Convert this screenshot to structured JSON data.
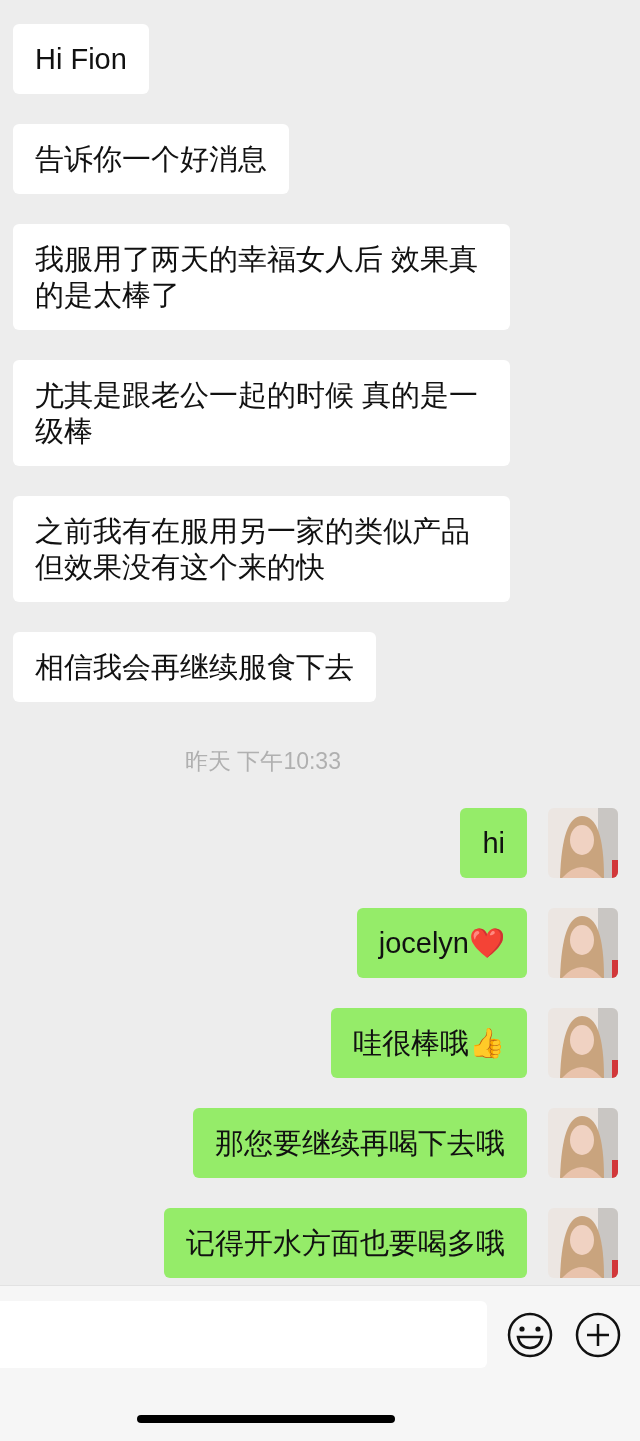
{
  "messages": [
    {
      "kind": "incoming",
      "text": "Hi Fion"
    },
    {
      "kind": "incoming",
      "text": "告诉你一个好消息"
    },
    {
      "kind": "incoming",
      "text": "我服用了两天的幸福女人后 效果真的是太棒了"
    },
    {
      "kind": "incoming",
      "text": "尤其是跟老公一起的时候 真的是一级棒"
    },
    {
      "kind": "incoming",
      "text": "之前我有在服用另一家的类似产品但效果没有这个来的快"
    },
    {
      "kind": "incoming",
      "text": "相信我会再继续服食下去"
    },
    {
      "kind": "timestamp",
      "text": "昨天 下午10:33"
    },
    {
      "kind": "outgoing",
      "text": "hi"
    },
    {
      "kind": "outgoing",
      "text": "jocelyn❤️"
    },
    {
      "kind": "outgoing",
      "text": "哇很棒哦👍"
    },
    {
      "kind": "outgoing",
      "text": "那您要继续再喝下去哦"
    },
    {
      "kind": "outgoing",
      "text": "记得开水方面也要喝多哦"
    }
  ]
}
